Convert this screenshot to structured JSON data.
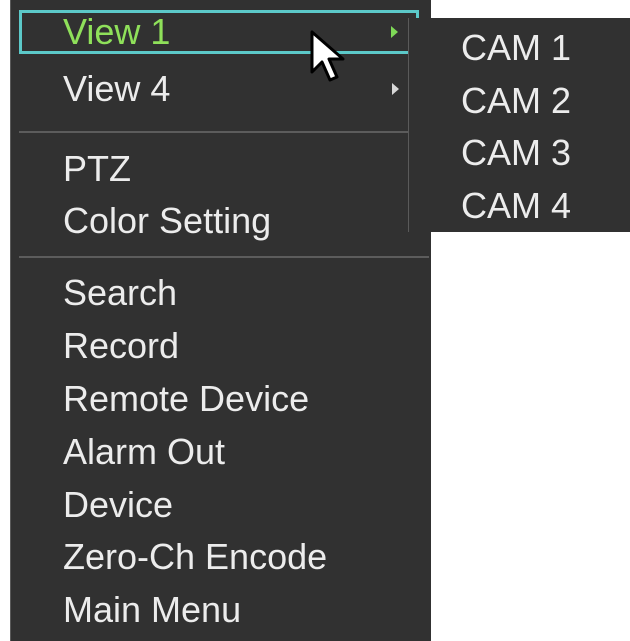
{
  "menu": {
    "items": [
      {
        "label": "View 1",
        "has_submenu": true,
        "selected": true
      },
      {
        "label": "View 4",
        "has_submenu": true
      },
      {
        "label": "PTZ"
      },
      {
        "label": "Color Setting"
      },
      {
        "label": "Search"
      },
      {
        "label": "Record"
      },
      {
        "label": "Remote Device"
      },
      {
        "label": "Alarm Out"
      },
      {
        "label": "Device"
      },
      {
        "label": "Zero-Ch Encode"
      },
      {
        "label": "Main Menu"
      }
    ]
  },
  "submenu": {
    "items": [
      {
        "label": "CAM 1"
      },
      {
        "label": "CAM 2"
      },
      {
        "label": "CAM 3"
      },
      {
        "label": "CAM 4"
      }
    ]
  },
  "colors": {
    "menu_background": "#313131",
    "text": "#ececec",
    "selected_text": "#8fe05a",
    "selection_border": "#5cc9c9",
    "divider": "#5c5c5c"
  },
  "icons": {
    "cursor": "mouse-pointer-icon",
    "submenu_arrow": "chevron-right-icon"
  }
}
